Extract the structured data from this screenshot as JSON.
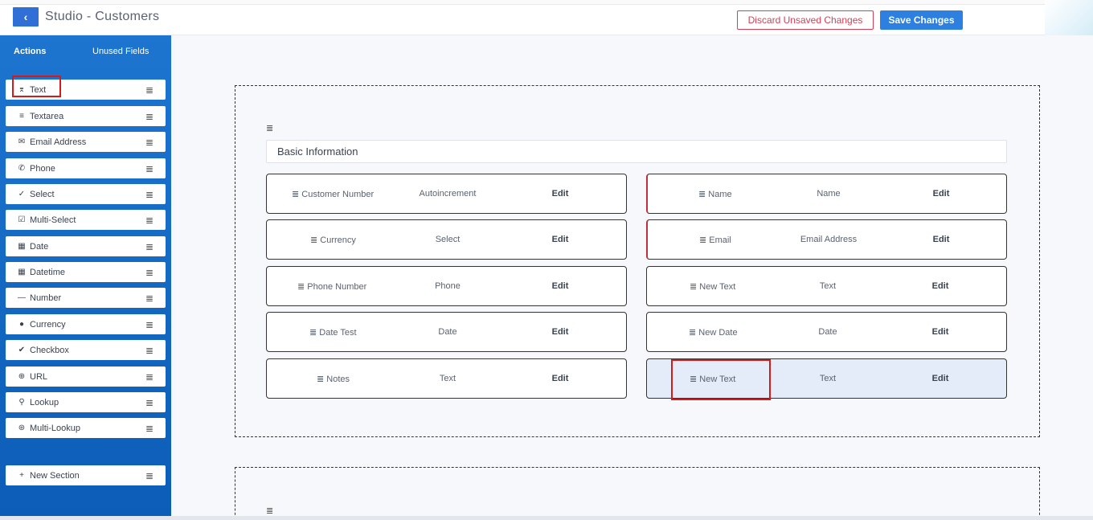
{
  "header": {
    "back_icon": "chevron-left-icon",
    "title": "Studio - Customers",
    "discard_label": "Discard Unsaved Changes",
    "save_label": "Save Changes",
    "colors": {
      "primary": "#2d7fe0",
      "danger": "#d43f55",
      "sidebar": "#1a6fca"
    }
  },
  "sidebar": {
    "tabs": [
      {
        "label": "Actions"
      },
      {
        "label": "Unused Fields"
      }
    ],
    "fields": [
      {
        "icon": "text-icon",
        "glyph": "⌆",
        "label": "Text"
      },
      {
        "icon": "textarea-icon",
        "glyph": "≡",
        "label": "Textarea"
      },
      {
        "icon": "envelope-icon",
        "glyph": "✉",
        "label": "Email Address"
      },
      {
        "icon": "phone-icon",
        "glyph": "✆",
        "label": "Phone"
      },
      {
        "icon": "check-icon",
        "glyph": "✓",
        "label": "Select"
      },
      {
        "icon": "checked-box-icon",
        "glyph": "☑",
        "label": "Multi-Select"
      },
      {
        "icon": "calendar-icon",
        "glyph": "▦",
        "label": "Date"
      },
      {
        "icon": "calendar-clock-icon",
        "glyph": "▦",
        "label": "Datetime"
      },
      {
        "icon": "minus-icon",
        "glyph": "—",
        "label": "Number"
      },
      {
        "icon": "circle-icon",
        "glyph": "●",
        "label": "Currency"
      },
      {
        "icon": "check-circle-icon",
        "glyph": "✔",
        "label": "Checkbox"
      },
      {
        "icon": "globe-icon",
        "glyph": "⊕",
        "label": "URL"
      },
      {
        "icon": "search-icon",
        "glyph": "⚲",
        "label": "Lookup"
      },
      {
        "icon": "search-plus-icon",
        "glyph": "⊛",
        "label": "Multi-Lookup"
      }
    ],
    "new_section": {
      "icon": "plus-icon",
      "glyph": "+",
      "label": "New Section"
    },
    "drag_glyph": "≣"
  },
  "canvas": {
    "sections": [
      {
        "title": "Basic Information",
        "left_fields": [
          {
            "name": "Customer Number",
            "type": "Autoincrement",
            "edit": "Edit",
            "required": false
          },
          {
            "name": "Currency",
            "type": "Select",
            "edit": "Edit",
            "required": false
          },
          {
            "name": "Phone Number",
            "type": "Phone",
            "edit": "Edit",
            "required": false
          },
          {
            "name": "Date Test",
            "type": "Date",
            "edit": "Edit",
            "required": false
          },
          {
            "name": "Notes",
            "type": "Text",
            "edit": "Edit",
            "required": false
          }
        ],
        "right_fields": [
          {
            "name": "Name",
            "type": "Name",
            "edit": "Edit",
            "required": true
          },
          {
            "name": "Email",
            "type": "Email Address",
            "edit": "Edit",
            "required": true
          },
          {
            "name": "New Text",
            "type": "Text",
            "edit": "Edit",
            "required": false
          },
          {
            "name": "New Date",
            "type": "Date",
            "edit": "Edit",
            "required": false
          },
          {
            "name": "New Text",
            "type": "Text",
            "edit": "Edit",
            "required": false,
            "selected": true
          }
        ]
      },
      {
        "title": ""
      }
    ],
    "drag_glyph": "≣"
  }
}
